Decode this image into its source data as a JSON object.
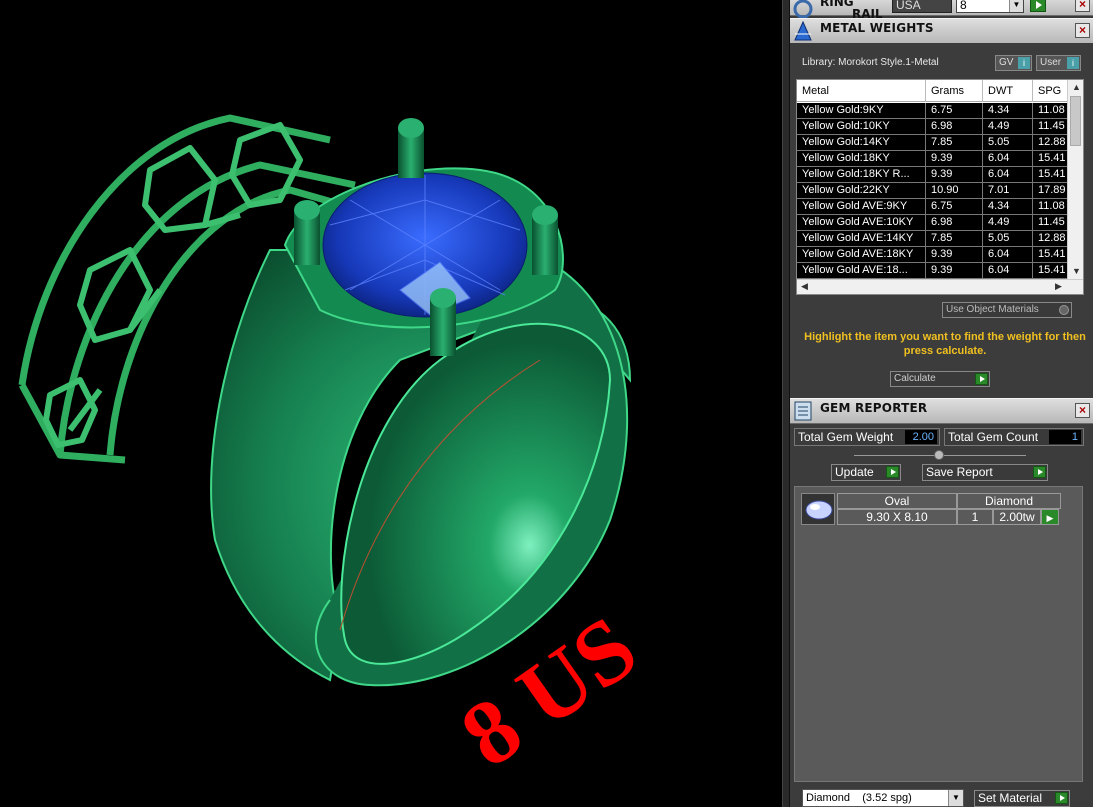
{
  "ring_rail": {
    "title_line1": "RING",
    "title_line2": "RAIL",
    "standard": "USA",
    "size": "8"
  },
  "viewport": {
    "size_label": "8 US",
    "label_color": "#ff0000",
    "metal_color": "#22a060",
    "stone_color": "#1a3ec0"
  },
  "metal_weights": {
    "title": "METAL WEIGHTS",
    "library": "Library: Morokort Style.1-Metal",
    "gv_label": "GV",
    "user_label": "User",
    "columns": [
      "Metal",
      "Grams",
      "DWT",
      "SPG"
    ],
    "rows": [
      [
        "Yellow Gold:9KY",
        "6.75",
        "4.34",
        "11.08"
      ],
      [
        "Yellow Gold:10KY",
        "6.98",
        "4.49",
        "11.45"
      ],
      [
        "Yellow Gold:14KY",
        "7.85",
        "5.05",
        "12.88"
      ],
      [
        "Yellow Gold:18KY",
        "9.39",
        "6.04",
        "15.41"
      ],
      [
        "Yellow Gold:18KY R...",
        "9.39",
        "6.04",
        "15.41"
      ],
      [
        "Yellow Gold:22KY",
        "10.90",
        "7.01",
        "17.89"
      ],
      [
        "Yellow Gold AVE:9KY",
        "6.75",
        "4.34",
        "11.08"
      ],
      [
        "Yellow Gold AVE:10KY",
        "6.98",
        "4.49",
        "11.45"
      ],
      [
        "Yellow Gold AVE:14KY",
        "7.85",
        "5.05",
        "12.88"
      ],
      [
        "Yellow Gold AVE:18KY",
        "9.39",
        "6.04",
        "15.41"
      ],
      [
        "Yellow Gold AVE:18...",
        "9.39",
        "6.04",
        "15.41"
      ]
    ],
    "use_object_materials": "Use Object Materials",
    "hint": "Highlight the item you want to find the weight for then press calculate.",
    "calculate": "Calculate"
  },
  "gem_reporter": {
    "title": "GEM REPORTER",
    "total_weight_label": "Total Gem Weight",
    "total_weight_value": "2.00",
    "total_count_label": "Total Gem Count",
    "total_count_value": "1",
    "update_label": "Update",
    "save_report_label": "Save Report",
    "gem": {
      "shape": "Oval",
      "material": "Diamond",
      "dimensions": "9.30 X 8.10",
      "count": "1",
      "weight": "2.00tw"
    },
    "material_select": "Diamond    (3.52 spg)",
    "set_material_label": "Set Material"
  }
}
